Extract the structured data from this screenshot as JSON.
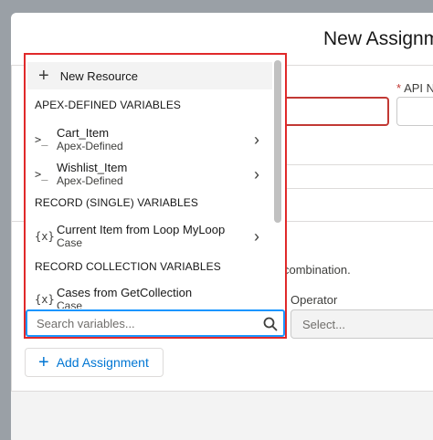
{
  "modal": {
    "title": "New Assignm",
    "api_name_label": "API N",
    "combination_text": "combination.",
    "operator_label": "Operator",
    "operator_select_value": "Select...",
    "add_assignment_label": "Add Assignment"
  },
  "dropdown": {
    "new_resource_label": "New Resource",
    "groups": [
      {
        "header": "APEX-DEFINED VARIABLES",
        "items": [
          {
            "name": "Cart_Item",
            "sub": "Apex-Defined",
            "icon": "apex-icon"
          },
          {
            "name": "Wishlist_Item",
            "sub": "Apex-Defined",
            "icon": "apex-icon"
          }
        ]
      },
      {
        "header": "RECORD (SINGLE) VARIABLES",
        "items": [
          {
            "name": "Current Item from Loop MyLoop",
            "sub": "Case",
            "icon": "variable-icon"
          }
        ]
      },
      {
        "header": "RECORD COLLECTION VARIABLES",
        "items": [
          {
            "name": "Cases from GetCollection",
            "sub": "Case",
            "icon": "variable-icon"
          }
        ]
      }
    ],
    "search_placeholder": "Search variables..."
  },
  "colors": {
    "highlight_border": "#e0292a",
    "focus_border": "#1b96ff",
    "brand_blue": "#0176d3",
    "error_red": "#c23934"
  }
}
